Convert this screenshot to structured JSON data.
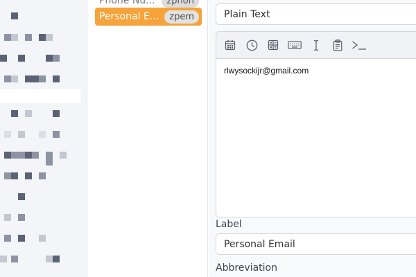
{
  "snippet_list": {
    "items": [
      {
        "name": "Phone Nu...",
        "abbreviation": "zphon",
        "state": "partial"
      },
      {
        "name": "Personal E...",
        "abbreviation": "zpem",
        "state": "active"
      }
    ]
  },
  "editor": {
    "content_type": {
      "value": "Plain Text"
    },
    "toolbar": {
      "icons": [
        "calendar-icon",
        "clock-icon",
        "calculator-icon",
        "keyboard-icon",
        "text-cursor-icon",
        "clipboard-icon",
        "terminal-icon"
      ]
    },
    "content": {
      "text": "rlwysockijr@gmail.com"
    },
    "label": {
      "title": "Label",
      "value": "Personal Email"
    },
    "abbreviation": {
      "title": "Abbreviation"
    }
  },
  "colors": {
    "accent": "#f5a33a",
    "sidebar_bg": "#f4f5f8",
    "editor_bg": "#f8f9fb"
  }
}
